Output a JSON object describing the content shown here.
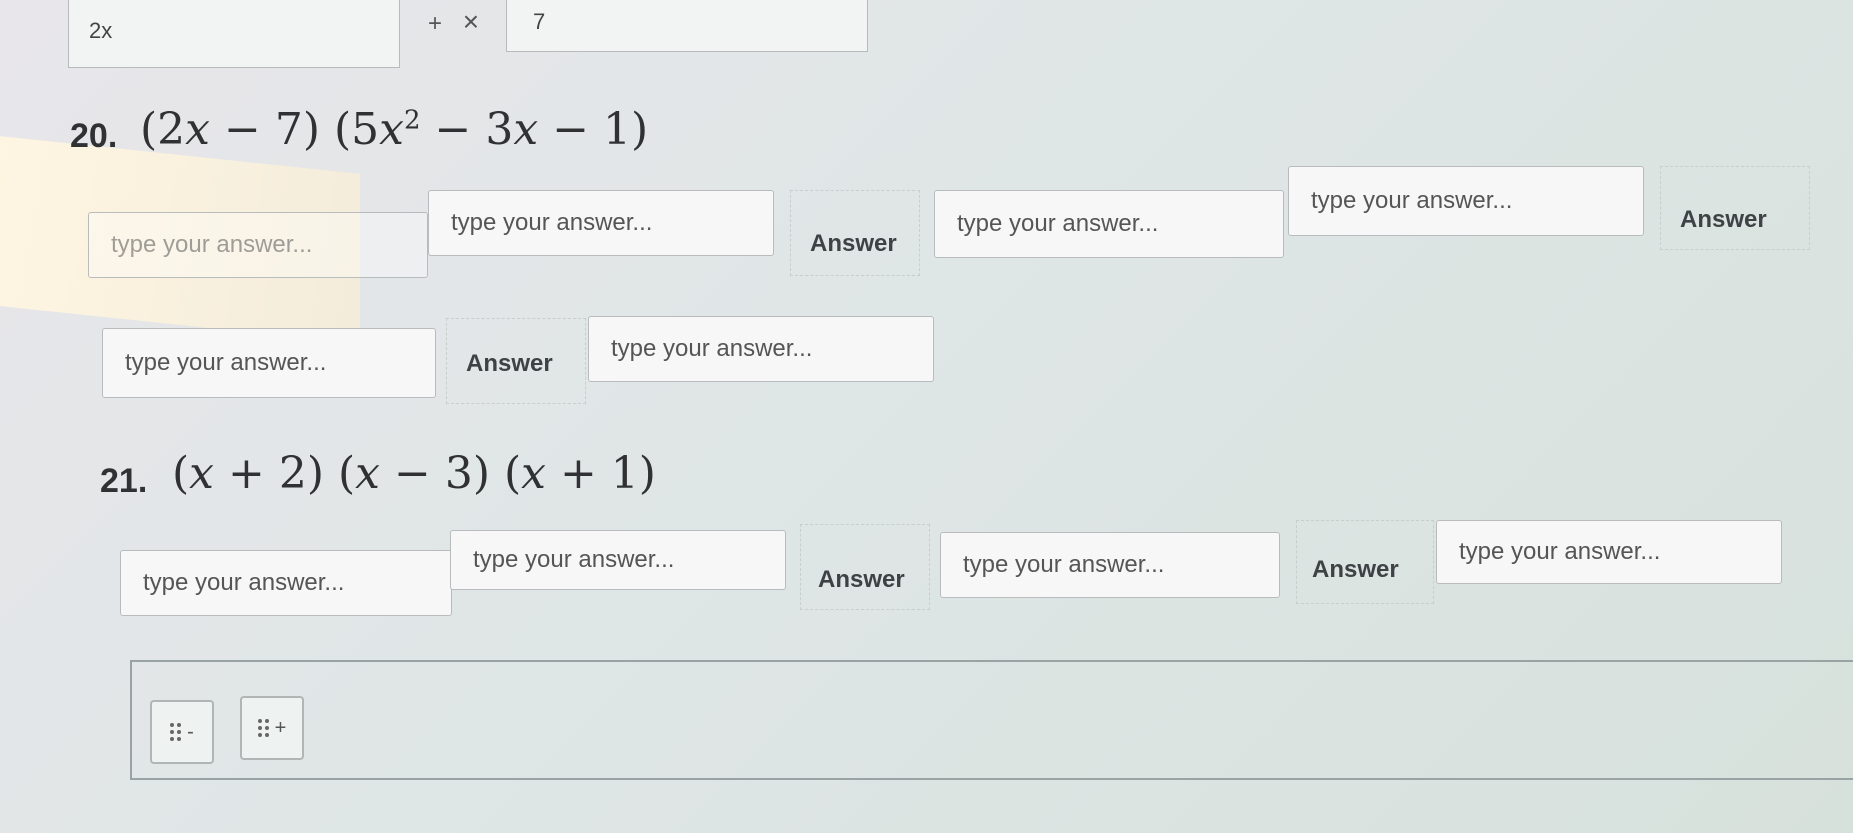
{
  "top_row": {
    "field1_value": "2x",
    "plus_symbol": "+",
    "times_symbol": "×",
    "field2_value": "7"
  },
  "problems": [
    {
      "number": "20.",
      "expression_parts": [
        "(2",
        "x",
        " − 7) (5",
        "x",
        "2",
        " − 3",
        "x",
        " − 1)"
      ],
      "placeholder": "type your answer...",
      "answer_label": "Answer"
    },
    {
      "number": "21.",
      "placeholder": "type your answer...",
      "answer_label": "Answer"
    }
  ],
  "placeholder": "type your answer...",
  "answer_label": "Answer",
  "math": {
    "p20_a": "(2",
    "p20_b": " − 7) (5",
    "p20_c": " − 3",
    "p20_d": " − 1)",
    "p20_exp": "2",
    "p21_a": "(",
    "p21_b": " + 2) (",
    "p21_c": " − 3) (",
    "p21_d": " + 1)",
    "var": "x"
  },
  "controls": {
    "remove_symbol": "-",
    "add_symbol": "+"
  }
}
